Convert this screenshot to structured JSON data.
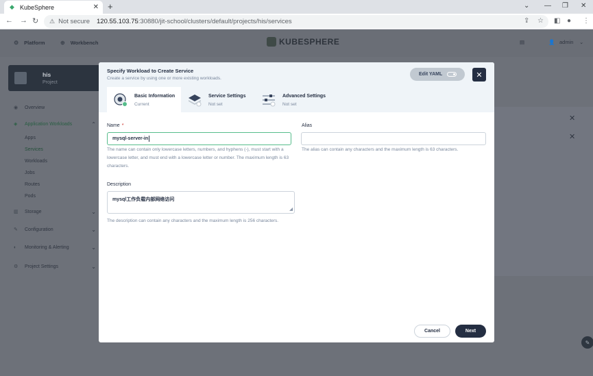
{
  "browser": {
    "tab_title": "KubeSphere",
    "security_label": "Not secure",
    "url_host": "120.55.103.75",
    "url_path": ":30880/jit-school/clusters/default/projects/his/services"
  },
  "topnav": {
    "platform": "Platform",
    "workbench": "Workbench",
    "logo": "KUBESPHERE",
    "user": "admin"
  },
  "project": {
    "name": "his",
    "type": "Project"
  },
  "sidebar": {
    "overview": "Overview",
    "app_workloads": "Application Workloads",
    "apps": "Apps",
    "services": "Services",
    "workloads": "Workloads",
    "jobs": "Jobs",
    "routes": "Routes",
    "pods": "Pods",
    "storage": "Storage",
    "configuration": "Configuration",
    "monitoring": "Monitoring & Alerting",
    "project_settings": "Project Settings"
  },
  "modal": {
    "title": "Specify Workload to Create Service",
    "subtitle": "Create a service by using one or more existing workloads.",
    "edit_yaml": "Edit YAML",
    "steps": [
      {
        "title": "Basic Information",
        "state": "Current"
      },
      {
        "title": "Service Settings",
        "state": "Not set"
      },
      {
        "title": "Advanced Settings",
        "state": "Not set"
      }
    ],
    "name_label": "Name",
    "name_required": "*",
    "name_value": "mysql-server-in",
    "name_help": "The name can contain only lowercase letters, numbers, and hyphens (-), must start with a lowercase letter, and must end with a lowercase letter or number. The maximum length is 63 characters.",
    "alias_label": "Alias",
    "alias_value": "",
    "alias_help": "The alias can contain any characters and the maximum length is 63 characters.",
    "description_label": "Description",
    "description_value": "mysql工作负载内部网络访问",
    "description_help": "The description can contain any characters and the maximum length is 256 characters.",
    "cancel": "Cancel",
    "next": "Next"
  },
  "colors": {
    "primary_dark": "#242e42",
    "accent_green": "#55bc8a",
    "header_bg": "#eff4f8"
  }
}
